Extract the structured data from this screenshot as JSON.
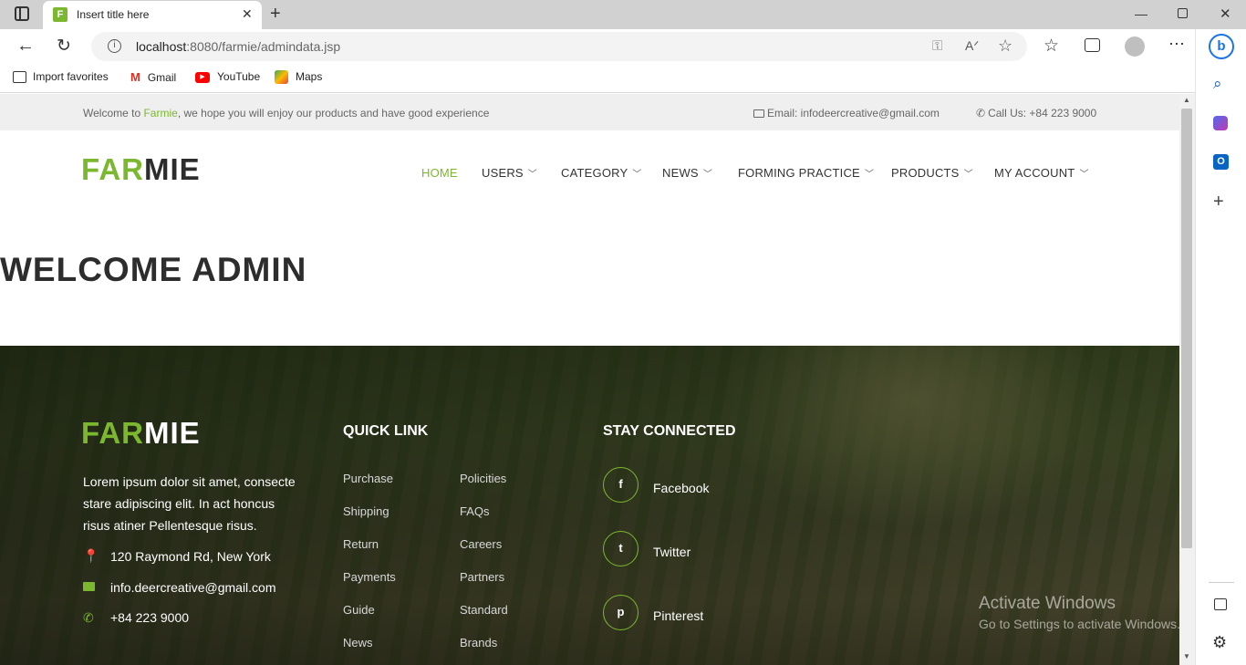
{
  "browser": {
    "tab_title": "Insert title here",
    "tab_favicon_letter": "F",
    "url_host": "localhost",
    "url_path": ":8080/farmie/admindata.jsp",
    "favorites": [
      {
        "label": "Import favorites",
        "icon": "import-icon"
      },
      {
        "label": "Gmail",
        "icon": "gmail-icon"
      },
      {
        "label": "YouTube",
        "icon": "youtube-icon"
      },
      {
        "label": "Maps",
        "icon": "maps-icon"
      }
    ]
  },
  "topbar": {
    "welcome_prefix": "Welcome to ",
    "brand_word": "Farmie",
    "welcome_suffix": ", we hope you will enjoy our products and have good experience",
    "email": "Email: infodeercreative@gmail.com",
    "phone": "Call Us: +84 223 9000"
  },
  "logo": {
    "green": "FAR",
    "dark": "MIE"
  },
  "nav": [
    {
      "label": "HOME",
      "dropdown": false,
      "active": true
    },
    {
      "label": "USERS",
      "dropdown": true
    },
    {
      "label": "CATEGORY",
      "dropdown": true
    },
    {
      "label": "NEWS",
      "dropdown": true
    },
    {
      "label": "FORMING PRACTICE",
      "dropdown": true
    },
    {
      "label": "PRODUCTS",
      "dropdown": true
    },
    {
      "label": "MY ACCOUNT",
      "dropdown": true
    }
  ],
  "main": {
    "heading": "WELCOME ADMIN"
  },
  "footer": {
    "description_lines": [
      "Lorem ipsum dolor sit amet, consecte",
      "stare adipiscing elit. In act honcus",
      "risus atiner Pellentesque risus."
    ],
    "address": "120 Raymond Rd, New York",
    "email": "info.deercreative@gmail.com",
    "phone": "+84 223 9000",
    "quick_link_title": "QUICK LINK",
    "links_col1": [
      "Purchase",
      "Shipping",
      "Return",
      "Payments",
      "Guide",
      "News"
    ],
    "links_col2": [
      "Policities",
      "FAQs",
      "Careers",
      "Partners",
      "Standard",
      "Brands"
    ],
    "stay_connected_title": "STAY CONNECTED",
    "social": [
      {
        "label": "Facebook",
        "glyph": "f"
      },
      {
        "label": "Twitter",
        "glyph": "t"
      },
      {
        "label": "Pinterest",
        "glyph": "p"
      }
    ]
  },
  "watermark": {
    "title": "Activate Windows",
    "subtitle": "Go to Settings to activate Windows."
  },
  "colors": {
    "accent": "#7cb82f",
    "text_dark": "#2d2d2d"
  }
}
